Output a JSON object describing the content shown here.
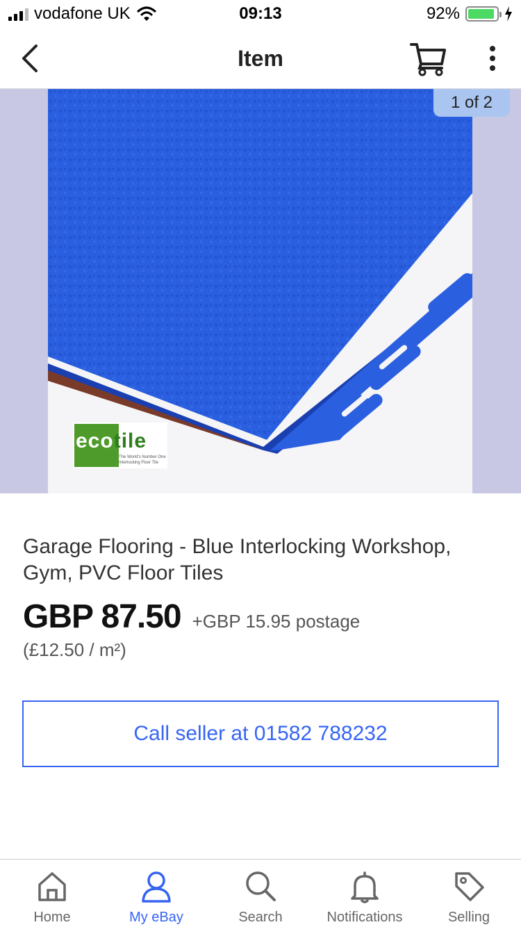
{
  "status_bar": {
    "carrier": "vodafone UK",
    "time": "09:13",
    "battery_percent": "92%",
    "battery_level": 0.92
  },
  "nav": {
    "title": "Item",
    "icons": [
      "back-chevron-icon",
      "cart-icon",
      "more-vertical-icon"
    ]
  },
  "gallery": {
    "counter": "1 of 2",
    "logo_word_1": "eco",
    "logo_word_2": "tile",
    "logo_tagline": "The World's Number One Interlocking Floor Tile"
  },
  "listing": {
    "title": "Garage Flooring - Blue Interlocking Workshop, Gym, PVC Floor Tiles",
    "price": "GBP 87.50",
    "postage": "+GBP 15.95 postage",
    "unit_price": "(£12.50 / m²)",
    "call_label": "Call seller at 01582 788232"
  },
  "tabs": [
    {
      "label": "Home",
      "icon": "home-icon"
    },
    {
      "label": "My eBay",
      "icon": "user-icon"
    },
    {
      "label": "Search",
      "icon": "search-icon"
    },
    {
      "label": "Notifications",
      "icon": "bell-icon"
    },
    {
      "label": "Selling",
      "icon": "tag-icon"
    }
  ],
  "colors": {
    "accent": "#3665f3",
    "tile_blue": "#2a5fe0",
    "gallery_bg": "#c8c8e4",
    "badge_bg": "#aac6f0"
  }
}
